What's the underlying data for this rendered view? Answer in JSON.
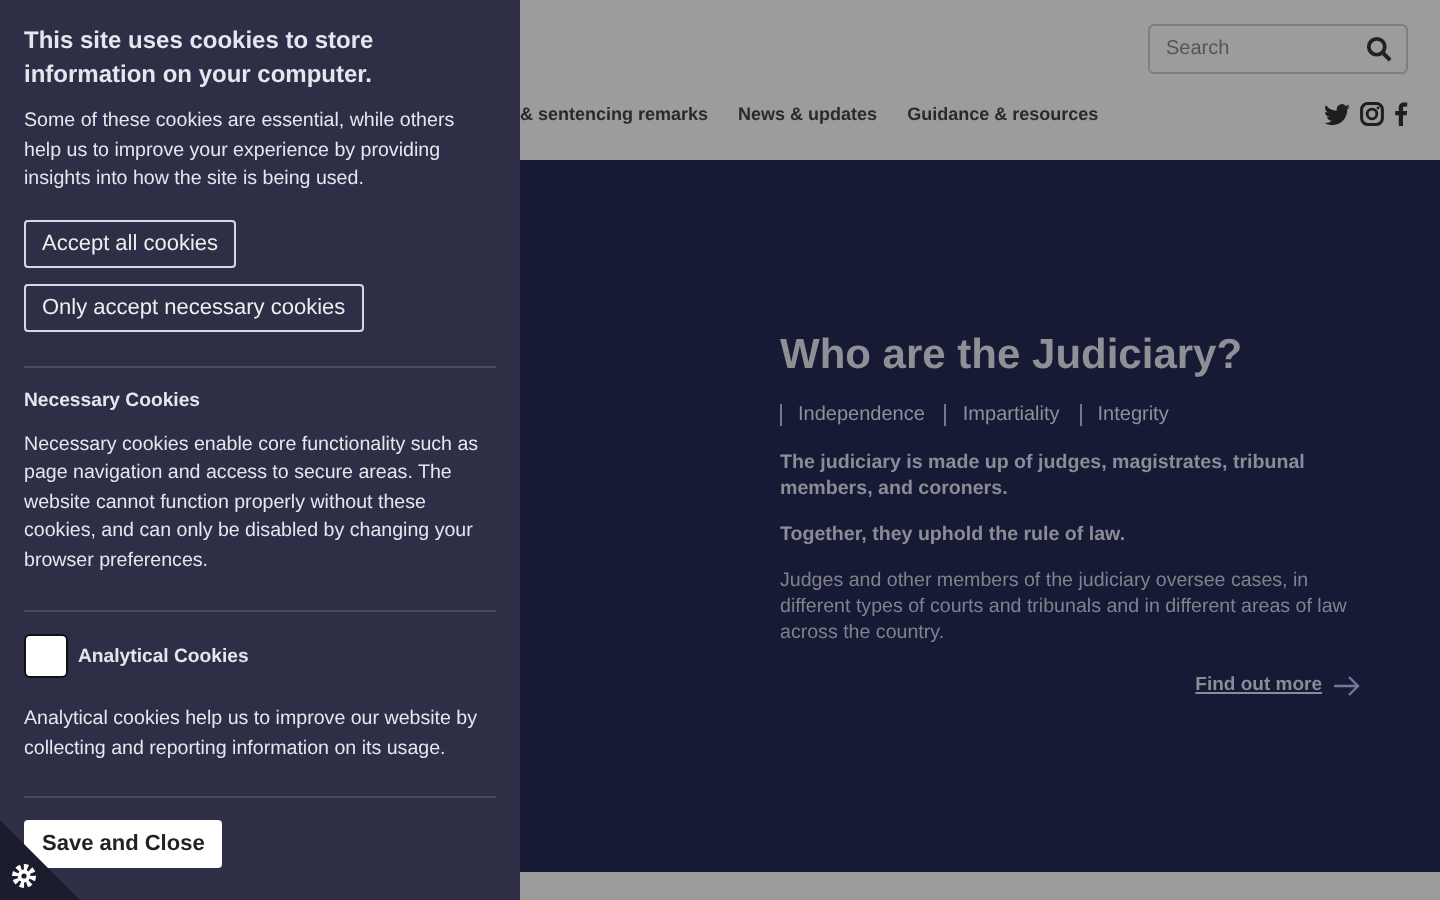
{
  "cookie_panel": {
    "title": "This site uses cookies to store information on your computer.",
    "intro": "Some of these cookies are essential, while others help us to improve your experience by providing insights into how the site is being used.",
    "buttons": [
      "Accept all cookies",
      "Only accept necessary cookies"
    ],
    "sections": [
      {
        "kind": "info",
        "title": "Necessary Cookies",
        "text": "Necessary cookies enable core functionality such as page navigation and access to secure areas. The website cannot function properly without these cookies, and can only be disabled by changing your browser preferences."
      },
      {
        "kind": "toggle",
        "title": "Analytical Cookies",
        "checked": false,
        "text": "Analytical cookies help us to improve our website by collecting and reporting information on its usage."
      }
    ],
    "save_button": "Save and Close"
  },
  "header": {
    "search": {
      "placeholder": "Search"
    },
    "nav": [
      {
        "label": "& sentencing remarks"
      },
      {
        "label": "News & updates"
      },
      {
        "label": "Guidance & resources"
      }
    ]
  },
  "hero": {
    "title": "Who are the Judiciary?",
    "values": [
      "Independence",
      "Impartiality",
      "Integrity"
    ],
    "paragraphs": [
      {
        "text": "The judiciary is made up of judges, magistrates, tribunal members, and coroners.",
        "bold": true
      },
      {
        "text": "Together, they uphold the rule of law.",
        "bold": true
      },
      {
        "text": "Judges and other members of the judiciary oversee cases, in different types of courts and tribunals and in different areas of law across the country.",
        "bold": false
      }
    ],
    "link": "Find out more"
  }
}
